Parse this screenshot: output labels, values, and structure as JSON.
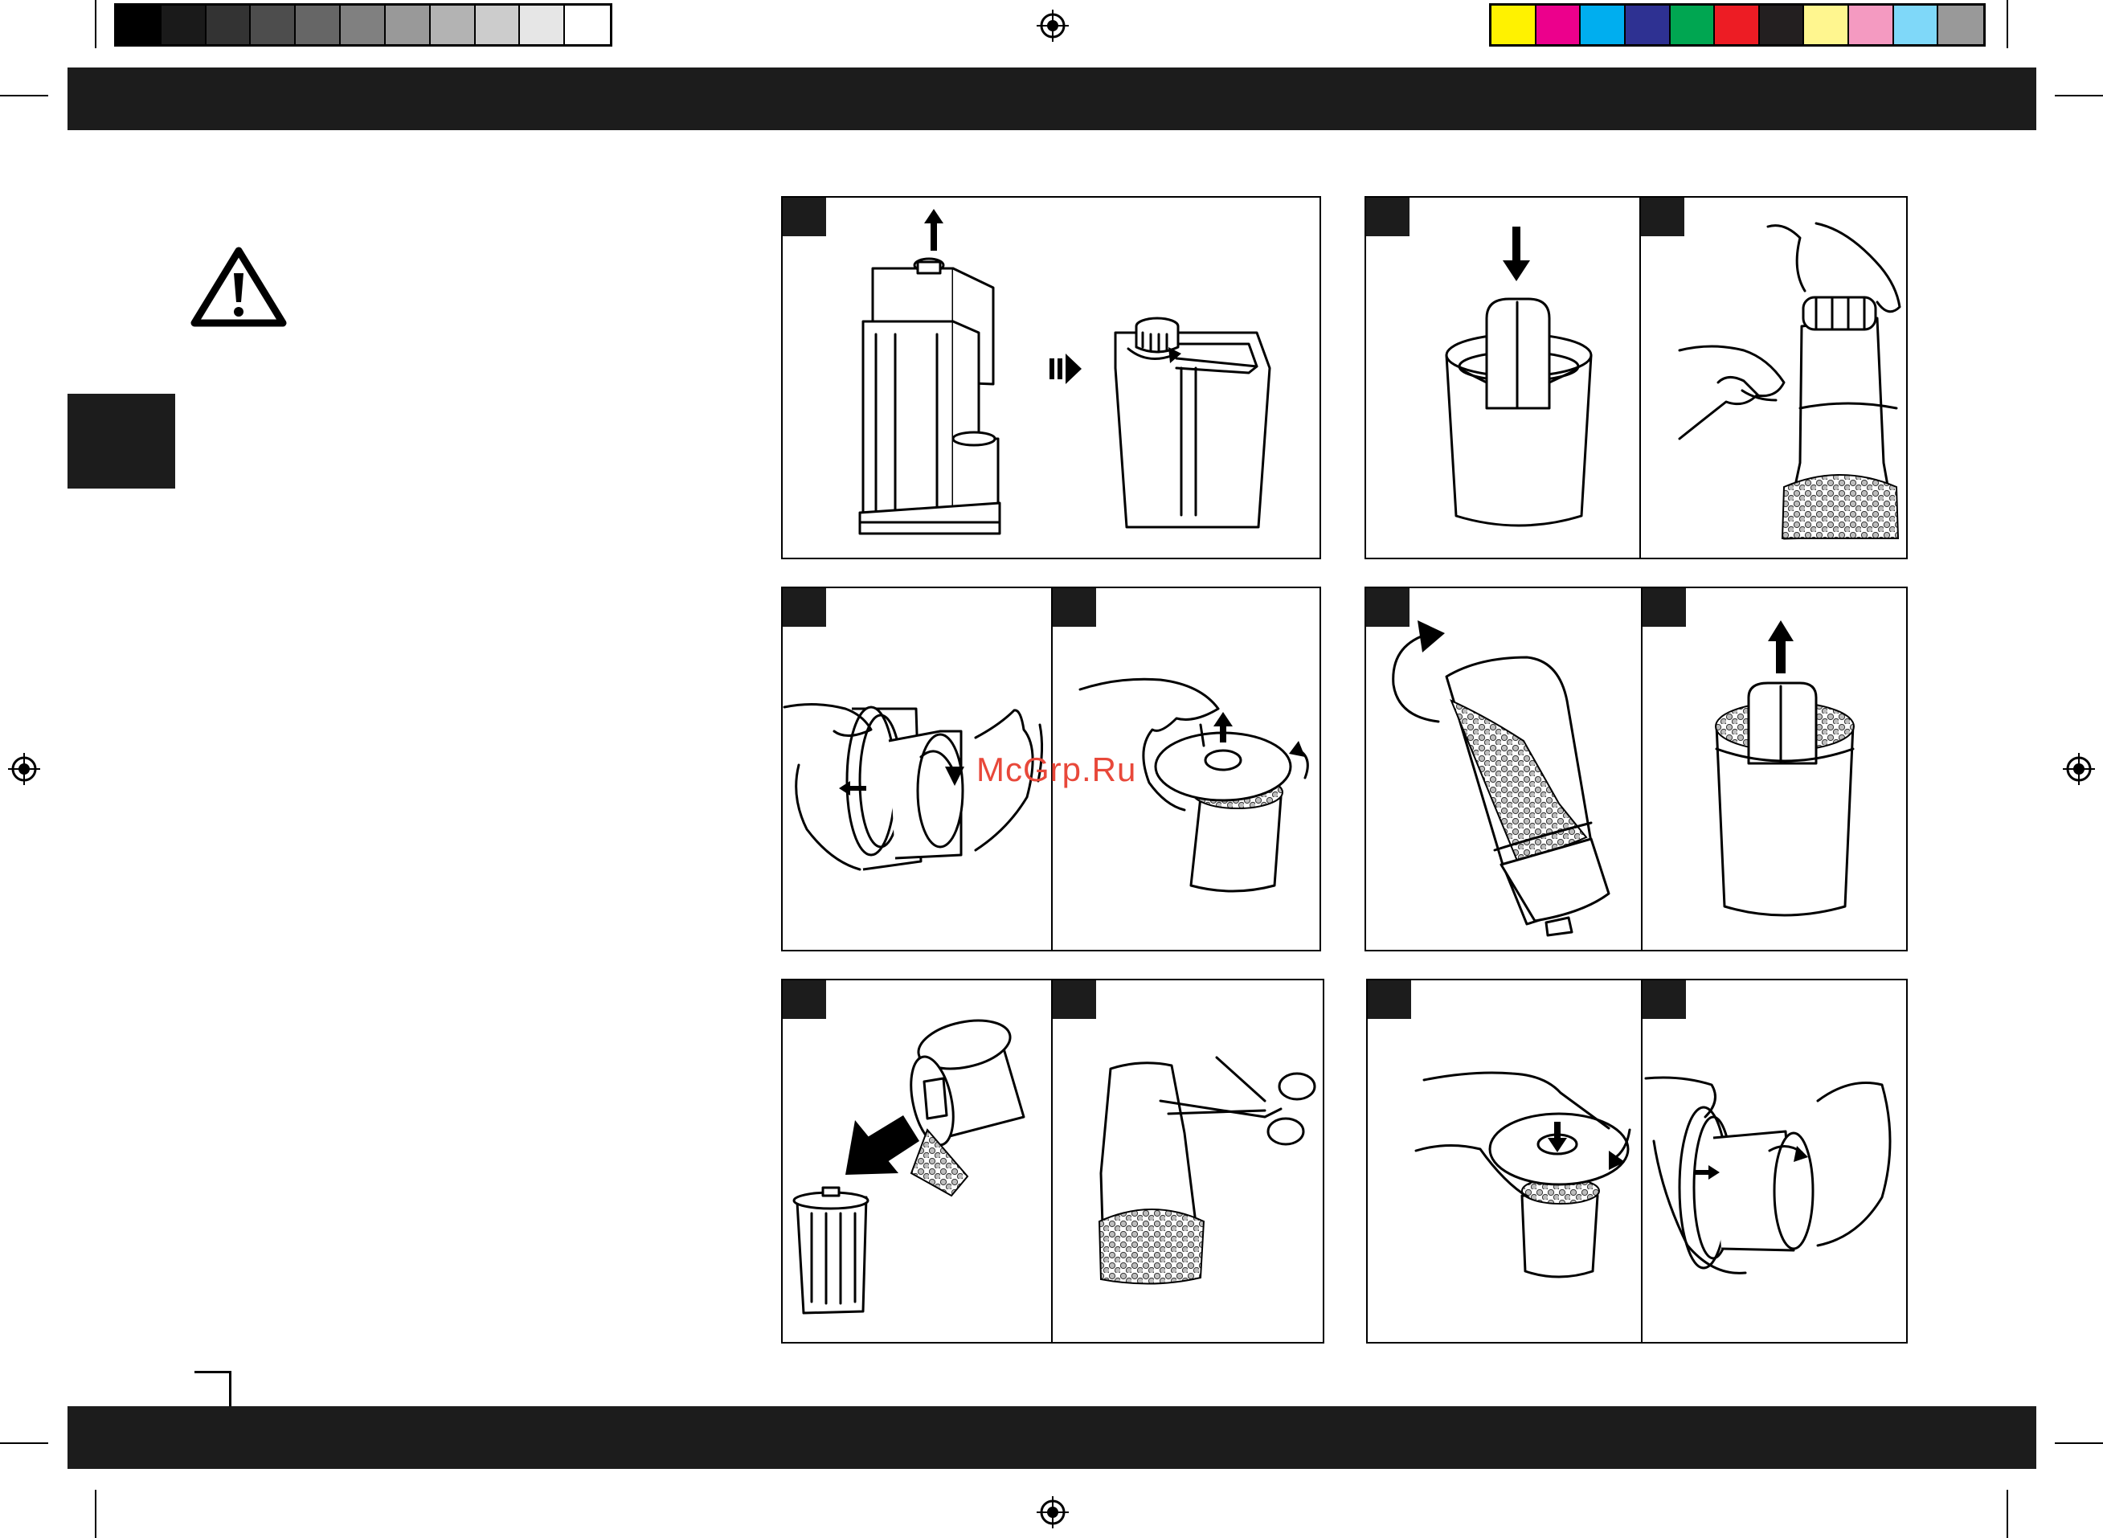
{
  "watermark": "McGrp.Ru",
  "colors": {
    "bar": "#1c1c1c",
    "grayscale": [
      "#000000",
      "#1a1a1a",
      "#333333",
      "#4d4d4d",
      "#666666",
      "#808080",
      "#999999",
      "#b3b3b3",
      "#cccccc",
      "#e6e6e6",
      "#ffffff"
    ],
    "process": [
      "#fff200",
      "#ec008c",
      "#00aeef",
      "#2e3192",
      "#00a651",
      "#ed1c24",
      "#231f20",
      "#fff68f",
      "#f49ac1",
      "#7fd8f9",
      "#999999"
    ]
  },
  "icons": [
    "warning-triangle-icon",
    "registration-mark-icon",
    "arrow-up-icon",
    "arrow-down-icon",
    "rotate-arrow-icon",
    "scissors-icon",
    "trash-bin-icon",
    "hand-icon"
  ],
  "steps": [
    {
      "panel": "panel-1",
      "scene": "lift-tank"
    },
    {
      "panel": "panel-2",
      "scene": "insert-cartridge"
    },
    {
      "panel": "panel-3",
      "scene": "tie-bag"
    },
    {
      "panel": "panel-4",
      "scene": "unscrew-cartridge"
    },
    {
      "panel": "panel-5",
      "scene": "open-lid"
    },
    {
      "panel": "panel-6",
      "scene": "shake-bag"
    },
    {
      "panel": "panel-7",
      "scene": "remove-insert"
    },
    {
      "panel": "panel-8",
      "scene": "empty-resin"
    },
    {
      "panel": "panel-9",
      "scene": "cut-bag"
    },
    {
      "panel": "panel-10",
      "scene": "close-lid"
    },
    {
      "panel": "panel-11",
      "scene": "screw-cartridge"
    }
  ]
}
